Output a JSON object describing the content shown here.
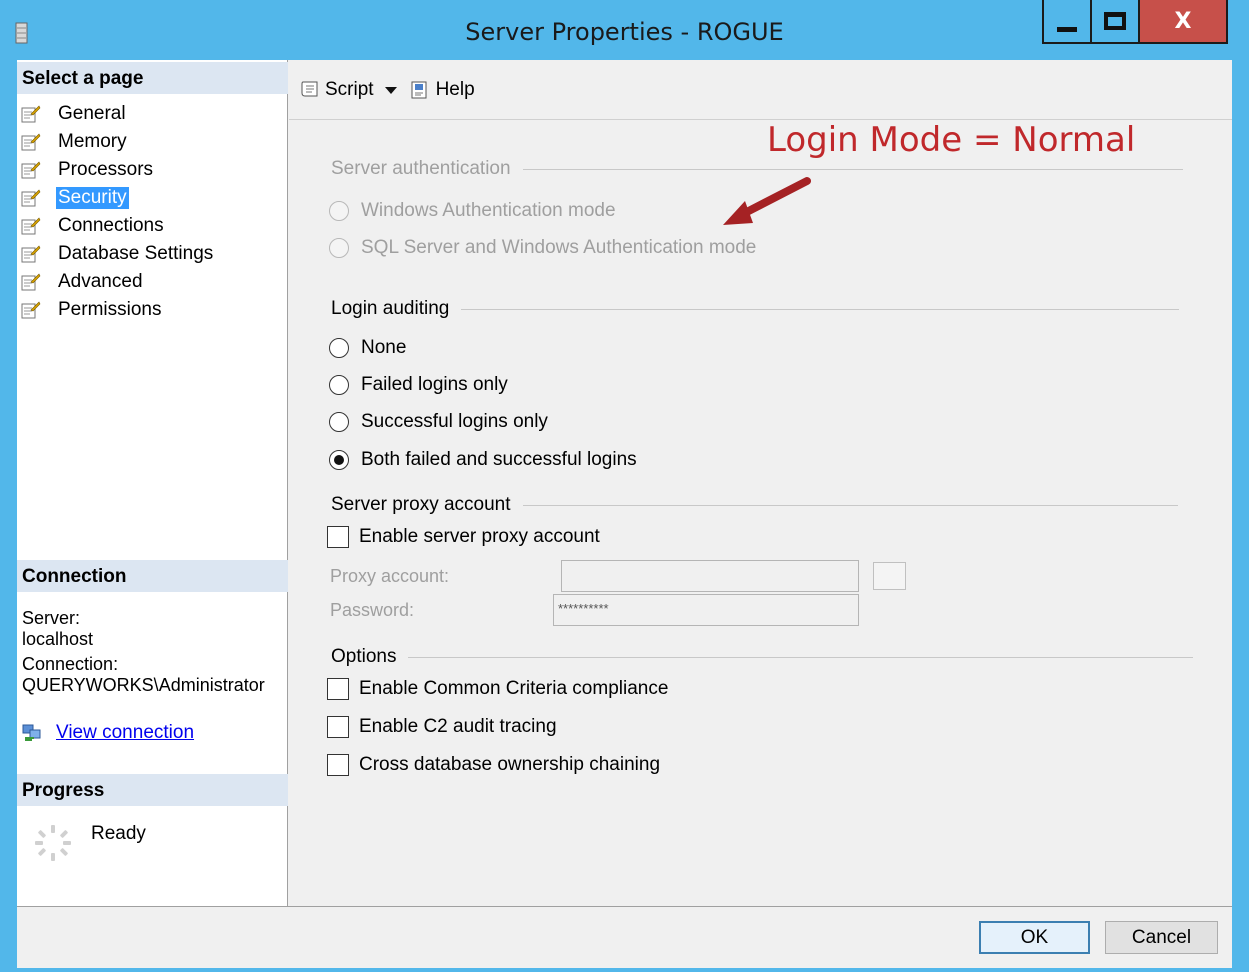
{
  "window": {
    "title": "Server Properties - ROGUE",
    "close_glyph": "X"
  },
  "left": {
    "select_page_header": "Select a page",
    "pages": [
      {
        "label": "General",
        "icon": "page-properties-icon"
      },
      {
        "label": "Memory",
        "icon": "page-properties-icon"
      },
      {
        "label": "Processors",
        "icon": "page-properties-icon"
      },
      {
        "label": "Security",
        "icon": "page-properties-icon",
        "selected": true
      },
      {
        "label": "Connections",
        "icon": "page-properties-icon"
      },
      {
        "label": "Database Settings",
        "icon": "page-properties-icon"
      },
      {
        "label": "Advanced",
        "icon": "page-properties-icon"
      },
      {
        "label": "Permissions",
        "icon": "page-properties-icon"
      }
    ],
    "connection_header": "Connection",
    "server_label": "Server:",
    "server_value": "localhost",
    "connection_label": "Connection:",
    "connection_value": "QUERYWORKS\\Administrator",
    "view_connection": "View connection",
    "progress_header": "Progress",
    "progress_status": "Ready"
  },
  "toolbar": {
    "script_label": "Script",
    "help_label": "Help"
  },
  "annotation": {
    "text": "Login Mode = Normal",
    "color": "#c0282b"
  },
  "server_auth": {
    "title": "Server authentication",
    "options": [
      "Windows Authentication mode",
      "SQL Server and Windows Authentication mode"
    ]
  },
  "login_auditing": {
    "title": "Login auditing",
    "options": [
      "None",
      "Failed logins only",
      "Successful logins only",
      "Both failed and successful logins"
    ],
    "selected": "Both failed and successful logins"
  },
  "proxy": {
    "title": "Server proxy account",
    "enable_label": "Enable server proxy account",
    "enabled": false,
    "proxy_account_label": "Proxy account:",
    "proxy_account_value": "",
    "password_label": "Password:",
    "password_value": "**********"
  },
  "options": {
    "title": "Options",
    "items": [
      {
        "label": "Enable Common Criteria compliance",
        "checked": false
      },
      {
        "label": "Enable C2 audit tracing",
        "checked": false
      },
      {
        "label": "Cross database ownership chaining",
        "checked": false
      }
    ]
  },
  "buttons": {
    "ok": "OK",
    "cancel": "Cancel"
  },
  "colors": {
    "titlebar": "#52b7ea",
    "close_button": "#c7504a",
    "selection": "#3399ff",
    "section_header": "#dce6f2",
    "link": "#0000ee"
  }
}
